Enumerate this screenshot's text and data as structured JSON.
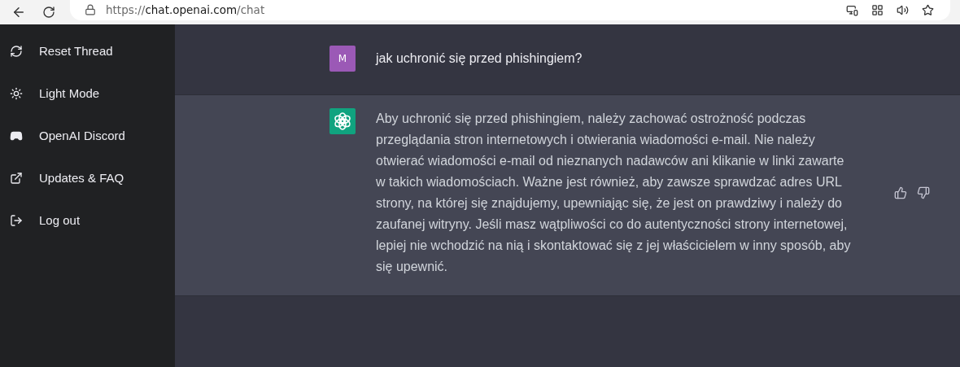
{
  "browser": {
    "url": {
      "prefix": "https://",
      "host": "chat.openai.com",
      "path": "/chat"
    }
  },
  "sidebar": {
    "items": [
      {
        "kind": "reset",
        "label": "Reset Thread"
      },
      {
        "kind": "theme",
        "label": "Light Mode"
      },
      {
        "kind": "discord",
        "label": "OpenAI Discord"
      },
      {
        "kind": "external",
        "label": "Updates & FAQ"
      },
      {
        "kind": "logout",
        "label": "Log out"
      }
    ]
  },
  "messages": [
    {
      "kind": "user",
      "avatar": "M",
      "text": "jak uchronić się przed phishingiem?"
    },
    {
      "kind": "assistant",
      "text": "Aby uchronić się przed phishingiem, należy zachować ostrożność podczas przeglądania stron internetowych i otwierania wiadomości e-mail. Nie należy otwierać wiadomości e-mail od nieznanych nadawców ani klikanie w linki zawarte w takich wiadomościach. Ważne jest również, aby zawsze sprawdzać adres URL strony, na której się znajdujemy, upewniając się, że jest on prawdziwy i należy do zaufanej witryny. Jeśli masz wątpliwości co do autentyczności strony internetowej, lepiej nie wchodzić na nią i skontaktować się z jej właścicielem w inny sposób, aby się upewnić."
    }
  ]
}
